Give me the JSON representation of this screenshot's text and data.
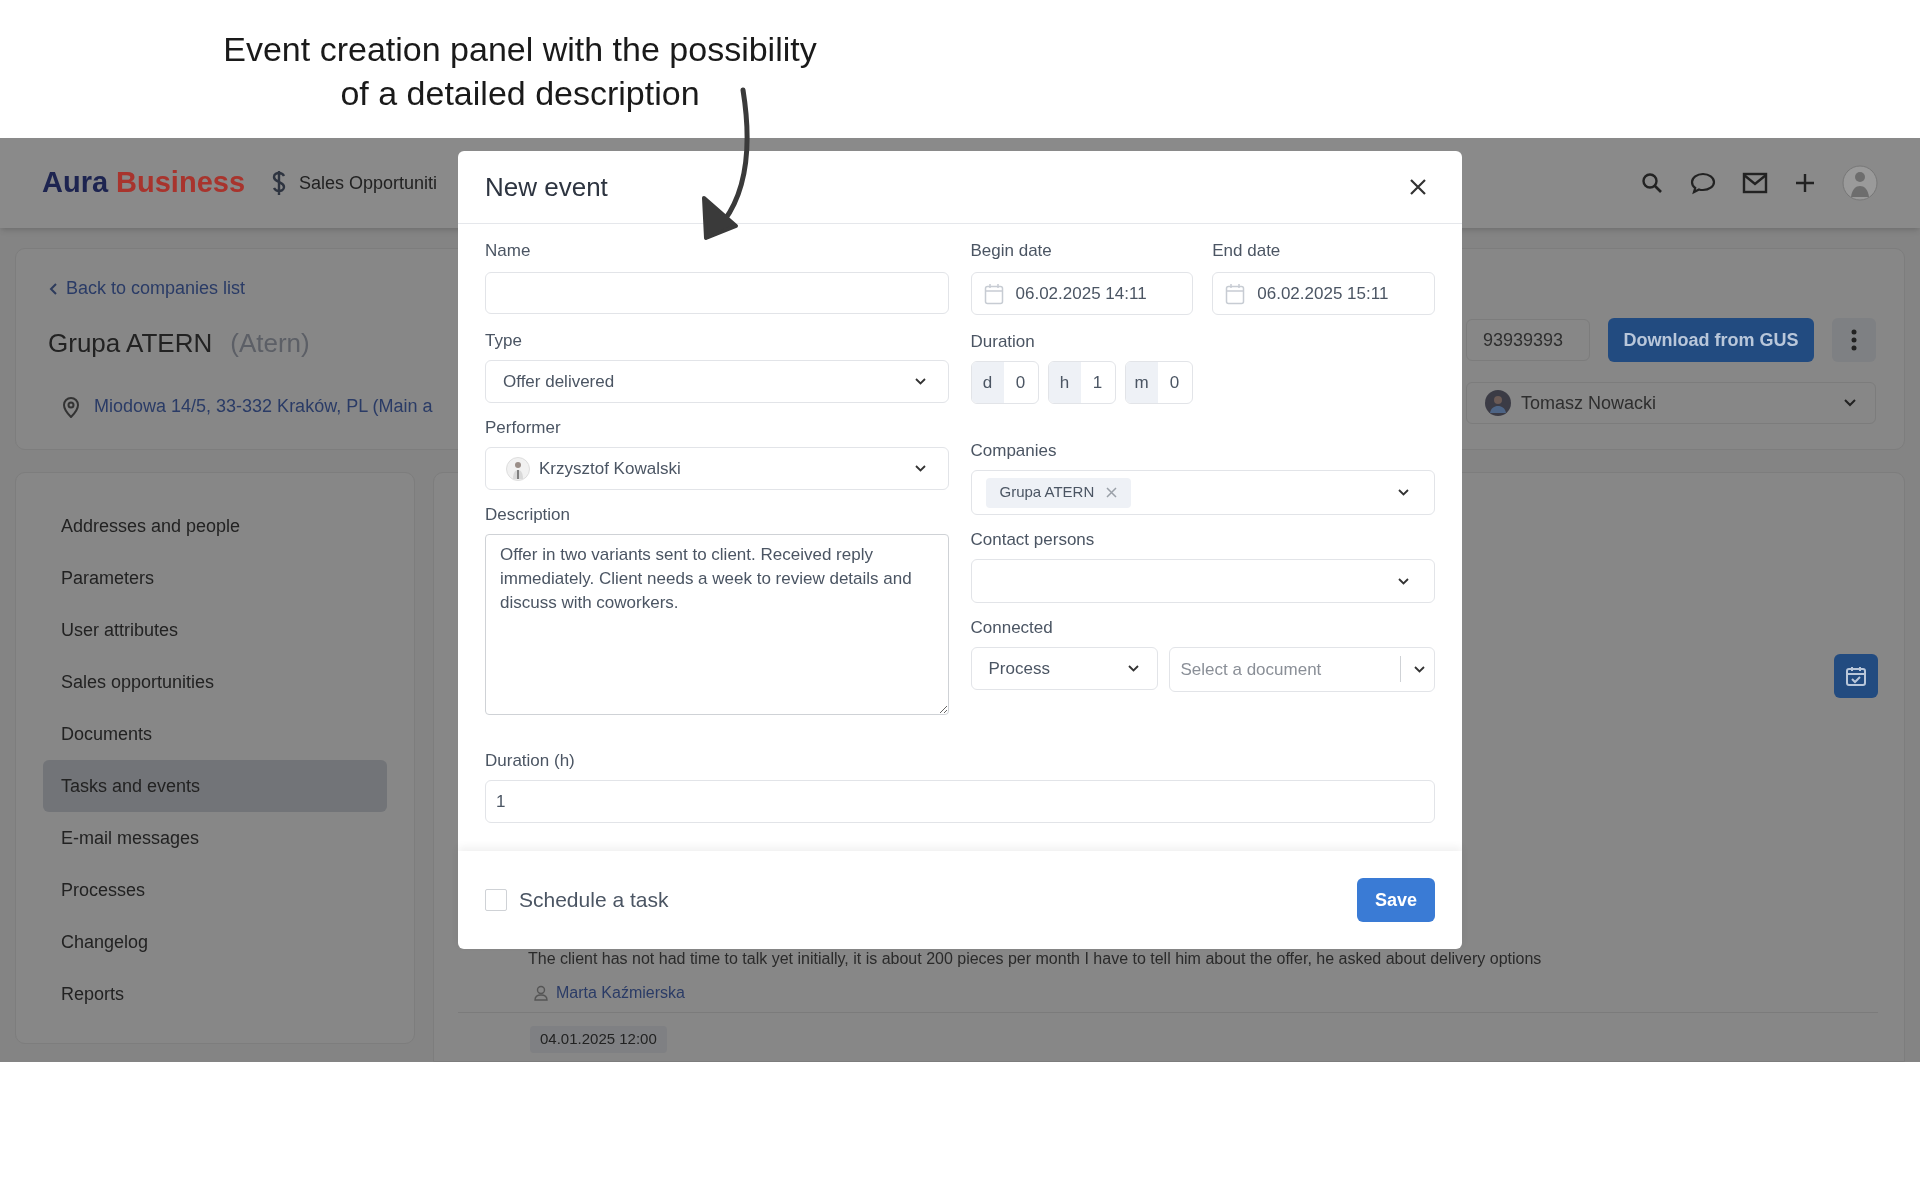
{
  "annotation": {
    "lines": [
      "Event creation panel with the possibility",
      "of a detailed description"
    ]
  },
  "header": {
    "logo_dark": "Aura",
    "logo_accent": "Business",
    "nav_item": "Sales Opportuniti"
  },
  "company": {
    "back_link": "Back to companies list",
    "name": "Grupa ATERN",
    "alias": "(Atern)",
    "address": "Miodowa 14/5, 33-332 Kraków, PL (Main a",
    "tax_id": "93939393",
    "download_button": "Download from GUS",
    "owner": "Tomasz Nowacki"
  },
  "sidebar": {
    "items": [
      {
        "label": "Addresses and people",
        "selected": false
      },
      {
        "label": "Parameters",
        "selected": false
      },
      {
        "label": "User attributes",
        "selected": false
      },
      {
        "label": "Sales opportunities",
        "selected": false
      },
      {
        "label": "Documents",
        "selected": false
      },
      {
        "label": "Tasks and events",
        "selected": true
      },
      {
        "label": "E-mail messages",
        "selected": false
      },
      {
        "label": "Processes",
        "selected": false
      },
      {
        "label": "Changelog",
        "selected": false
      },
      {
        "label": "Reports",
        "selected": false
      }
    ]
  },
  "activity": {
    "text": "The client has not had time to talk yet initially, it is about 200 pieces per month I have to tell him about the offer, he asked about delivery options",
    "author": "Marta Kaźmierska",
    "date": "04.01.2025 12:00"
  },
  "modal": {
    "title": "New event",
    "name": {
      "label": "Name"
    },
    "type": {
      "label": "Type",
      "value": "Offer delivered"
    },
    "performer": {
      "label": "Performer",
      "value": "Krzysztof Kowalski"
    },
    "description": {
      "label": "Description",
      "value": "Offer in two variants sent to client. Received reply immediately. Client needs a week to review details and discuss with coworkers."
    },
    "begin_date": {
      "label": "Begin date",
      "value": "06.02.2025 14:11"
    },
    "end_date": {
      "label": "End date",
      "value": "06.02.2025 15:11"
    },
    "duration": {
      "label": "Duration",
      "parts": [
        {
          "unit": "d",
          "value": "0"
        },
        {
          "unit": "h",
          "value": "1"
        },
        {
          "unit": "m",
          "value": "0"
        }
      ]
    },
    "companies": {
      "label": "Companies",
      "tags": [
        "Grupa ATERN"
      ]
    },
    "contact_persons": {
      "label": "Contact persons"
    },
    "connected": {
      "label": "Connected",
      "value": "Process",
      "document_placeholder": "Select a document"
    },
    "duration_h": {
      "label": "Duration (h)",
      "value": "1"
    },
    "schedule_task": {
      "label": "Schedule a task",
      "checked": false
    },
    "save_button": "Save"
  }
}
